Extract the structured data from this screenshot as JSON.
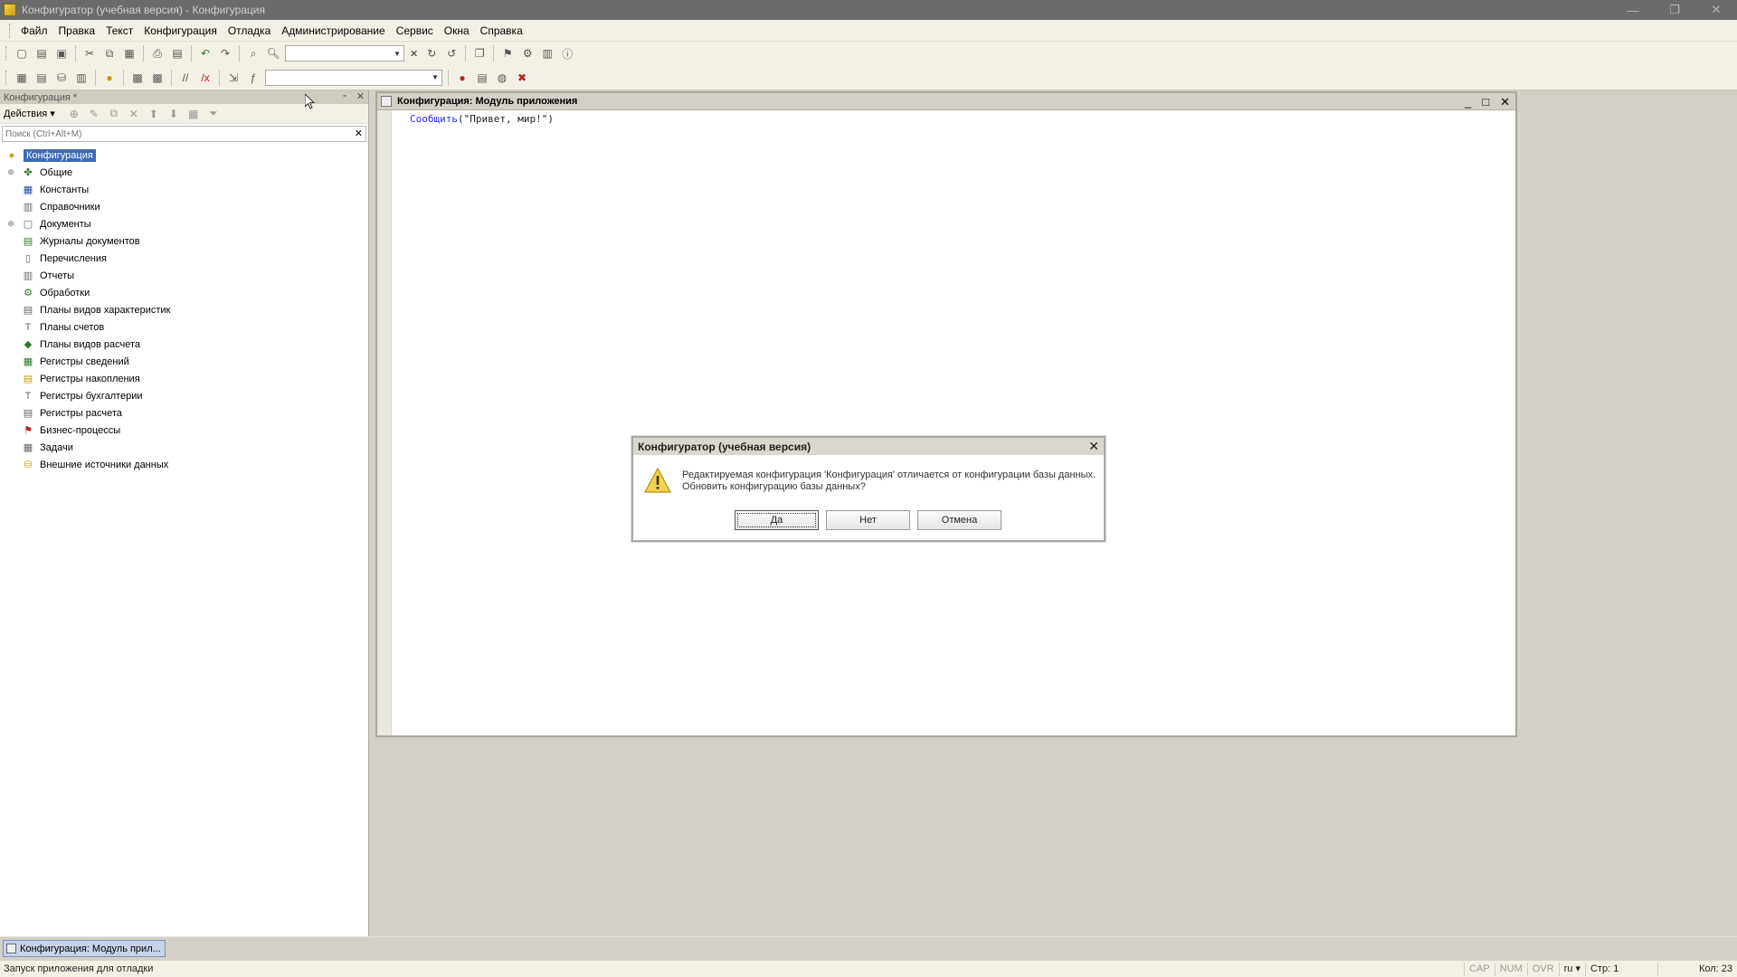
{
  "window": {
    "title": "Конфигуратор (учебная версия) - Конфигурация",
    "controls": [
      "—",
      "❐",
      "✕"
    ]
  },
  "menu": [
    "Файл",
    "Правка",
    "Текст",
    "Конфигурация",
    "Отладка",
    "Администрирование",
    "Сервис",
    "Окна",
    "Справка"
  ],
  "left_panel": {
    "title": "Конфигурация *",
    "actions_label": "Действия ▾",
    "search_placeholder": "Поиск (Ctrl+Alt+M)",
    "tree_root": "Конфигурация",
    "tree_items": [
      {
        "label": "Общие",
        "icon": "common-icon",
        "expandable": true
      },
      {
        "label": "Константы",
        "icon": "constants-icon",
        "expandable": false
      },
      {
        "label": "Справочники",
        "icon": "catalogs-icon",
        "expandable": false
      },
      {
        "label": "Документы",
        "icon": "documents-icon",
        "expandable": true
      },
      {
        "label": "Журналы документов",
        "icon": "journals-icon",
        "expandable": false
      },
      {
        "label": "Перечисления",
        "icon": "enums-icon",
        "expandable": false
      },
      {
        "label": "Отчеты",
        "icon": "reports-icon",
        "expandable": false
      },
      {
        "label": "Обработки",
        "icon": "processing-icon",
        "expandable": false
      },
      {
        "label": "Планы видов характеристик",
        "icon": "char-plans-icon",
        "expandable": false
      },
      {
        "label": "Планы счетов",
        "icon": "accounts-plans-icon",
        "expandable": false
      },
      {
        "label": "Планы видов расчета",
        "icon": "calc-plans-icon",
        "expandable": false
      },
      {
        "label": "Регистры сведений",
        "icon": "info-registers-icon",
        "expandable": false
      },
      {
        "label": "Регистры накопления",
        "icon": "accum-registers-icon",
        "expandable": false
      },
      {
        "label": "Регистры бухгалтерии",
        "icon": "acct-registers-icon",
        "expandable": false
      },
      {
        "label": "Регистры расчета",
        "icon": "calc-registers-icon",
        "expandable": false
      },
      {
        "label": "Бизнес-процессы",
        "icon": "bizproc-icon",
        "expandable": false
      },
      {
        "label": "Задачи",
        "icon": "tasks-icon",
        "expandable": false
      },
      {
        "label": "Внешние источники данных",
        "icon": "external-sources-icon",
        "expandable": false
      }
    ]
  },
  "document": {
    "title": "Конфигурация: Модуль приложения",
    "code_keyword": "Сообщить",
    "code_rest": "(\"Привет, мир!\")"
  },
  "dialog": {
    "title": "Конфигуратор (учебная версия)",
    "message_line1": "Редактируемая конфигурация 'Конфигурация' отличается от конфигурации базы данных.",
    "message_line2": "Обновить конфигурацию базы данных?",
    "btn_yes": "Да",
    "btn_no": "Нет",
    "btn_cancel": "Отмена"
  },
  "window_list": {
    "item": "Конфигурация: Модуль прил..."
  },
  "status": {
    "text": "Запуск приложения для отладки",
    "cap": "CAP",
    "num": "NUM",
    "ovr": "OVR",
    "lang": "ru ▾",
    "line": "Стр: 1",
    "col": "Кол: 23"
  }
}
